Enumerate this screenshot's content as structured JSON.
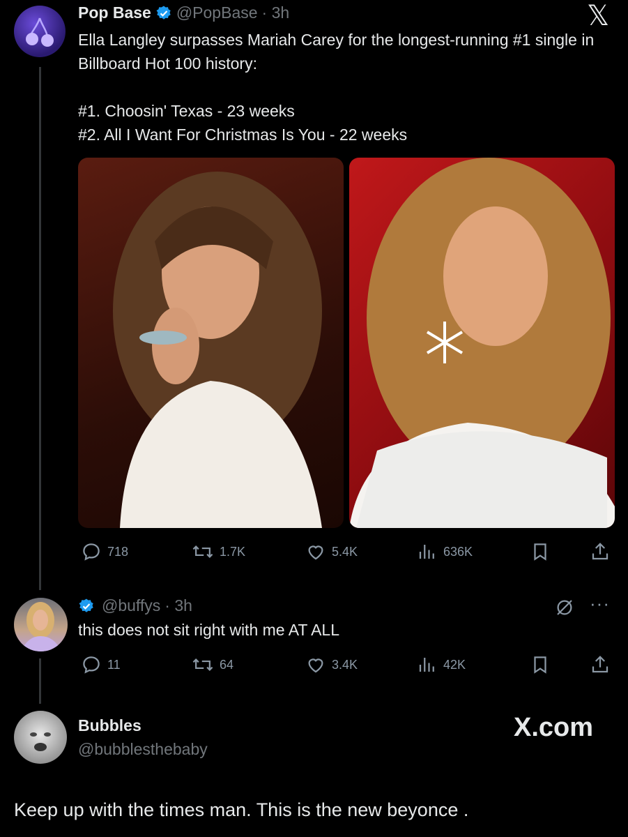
{
  "tweet": {
    "name": "Pop Base",
    "handle": "@PopBase",
    "time": "· 3h",
    "text": "Ella Langley surpasses Mariah Carey for the longest-running #1 single in Billboard Hot 100 history:\n\n#1. Choosin' Texas - 23 weeks\n#2. All I Want For Christmas Is You - 22 weeks",
    "stats": {
      "replies": "718",
      "reposts": "1.7K",
      "likes": "5.4K",
      "views": "636K"
    }
  },
  "reply": {
    "handle": "@buffys",
    "time": "· 3h",
    "text": "this does not sit right with me AT ALL",
    "stats": {
      "replies": "11",
      "reposts": "64",
      "likes": "3.4K",
      "views": "42K"
    }
  },
  "quote": {
    "name": "Bubbles",
    "handle": "@bubblesthebaby",
    "site": "X.com",
    "text": "Keep up with the times man. This is the new beyonce ."
  },
  "icons": {
    "brand": "x-logo-icon",
    "verified": "verified-badge-icon"
  },
  "colors": {
    "background": "#000000",
    "verified": "#1d9bf0",
    "muted": "#71767b"
  }
}
